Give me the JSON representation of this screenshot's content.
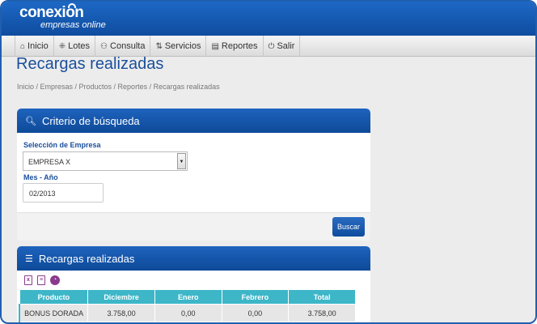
{
  "logo": {
    "main": "conexion",
    "sub": "empresas online"
  },
  "nav": [
    {
      "label": "Inicio",
      "icon": "⌂"
    },
    {
      "label": "Lotes",
      "icon": "⁜"
    },
    {
      "label": "Consulta",
      "icon": "⚇"
    },
    {
      "label": "Servicios",
      "icon": "⇅"
    },
    {
      "label": "Reportes",
      "icon": "▤"
    },
    {
      "label": "Salir",
      "icon": "⏻"
    }
  ],
  "page": {
    "title": "Recargas realizadas",
    "breadcrumb": "Inicio / Empresas / Productos / Reportes / Recargas realizadas"
  },
  "search": {
    "header": "Criterio de búsqueda",
    "company_label": "Selección de Empresa",
    "company_value": "EMPRESA X",
    "period_label": "Mes - Año",
    "period_value": "02/2013",
    "button": "Buscar"
  },
  "results": {
    "header": "Recargas realizadas",
    "columns": [
      "Producto",
      "Diciembre",
      "Enero",
      "Febrero",
      "Total"
    ],
    "rows": [
      [
        "BONUS DORADA",
        "3.758,00",
        "0,00",
        "0,00",
        "3.758,00"
      ]
    ]
  },
  "colors": {
    "brand": "#0f4c9f",
    "table_header": "#3db6c8"
  }
}
